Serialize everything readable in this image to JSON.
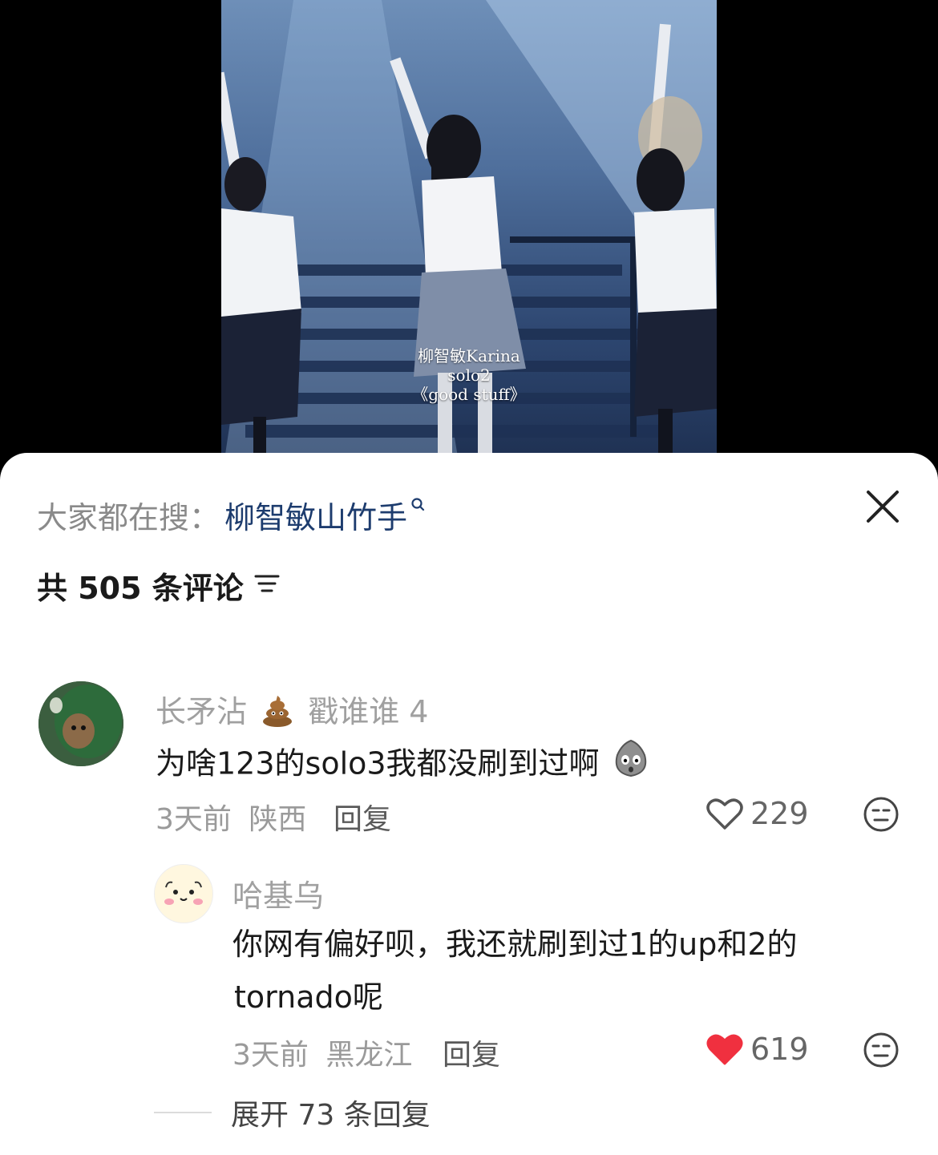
{
  "video": {
    "caption_lines": [
      "柳智敏Karina",
      "solo2",
      "《good stuff》"
    ]
  },
  "search": {
    "prefix": "大家都在搜：",
    "term": "柳智敏山竹手"
  },
  "comments_header": {
    "count_text": "共 505 条评论"
  },
  "comments": [
    {
      "username": "长矛沾",
      "username_suffix": "戳谁谁 4",
      "text": "为啥123的solo3我都没刷到过啊",
      "time": "3天前",
      "location": "陕西",
      "reply_label": "回复",
      "likes": "229",
      "liked": false
    },
    {
      "username": "哈基乌",
      "text_line1": "你网有偏好呗，我还就刷到过1的up和2的",
      "text_line2": "tornado呢",
      "time": "3天前",
      "location": "黑龙江",
      "reply_label": "回复",
      "likes": "619",
      "liked": true
    }
  ],
  "expand": {
    "label": "展开 73 条回复"
  },
  "colors": {
    "search_term": "#1d3c6e",
    "liked_heart": "#f0303f",
    "username": "#a0a0a0"
  }
}
